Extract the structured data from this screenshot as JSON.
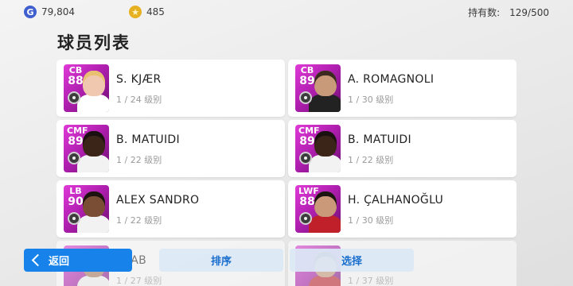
{
  "currency": {
    "gp": "79,804",
    "coins": "485"
  },
  "owned": {
    "label": "持有数:",
    "value": "129/500"
  },
  "page_title": "球员列表",
  "players": [
    {
      "pos": "CB",
      "rating": "88",
      "name": "S. KJÆR",
      "level": "1 / 24 级别",
      "skin": "#f0c8b0",
      "hair": "#e8c070",
      "kit": "#ffffff"
    },
    {
      "pos": "CB",
      "rating": "89",
      "name": "A. ROMAGNOLI",
      "level": "1 / 30 级别",
      "skin": "#c99a7a",
      "hair": "#3a2a20",
      "kit": "#222222"
    },
    {
      "pos": "CMF",
      "rating": "89",
      "name": "B. MATUIDI",
      "level": "1 / 22 级别",
      "skin": "#3b2418",
      "hair": "#1a1010",
      "kit": "#f2f2f2"
    },
    {
      "pos": "CMF",
      "rating": "89",
      "name": "B. MATUIDI",
      "level": "1 / 22 级别",
      "skin": "#3b2418",
      "hair": "#1a1010",
      "kit": "#f2f2f2"
    },
    {
      "pos": "LB",
      "rating": "90",
      "name": "ALEX SANDRO",
      "level": "1 / 22 级别",
      "skin": "#7a4e34",
      "hair": "#1c1210",
      "kit": "#f2f2f2"
    },
    {
      "pos": "LWF",
      "rating": "88",
      "name": "H. ÇALHANOĞLU",
      "level": "1 / 30 级别",
      "skin": "#c9997a",
      "hair": "#1c1410",
      "kit": "#c0202a"
    },
    {
      "pos": "",
      "rating": "",
      "name": "ALAB",
      "level": "1 / 27 级别",
      "skin": "#a8765a",
      "hair": "#1c1410",
      "kit": "#f2f2f2"
    },
    {
      "pos": "",
      "rating": "",
      "name": "",
      "level": "1 / 37 级别",
      "skin": "#c9997a",
      "hair": "#2a1a10",
      "kit": "#c0202a"
    }
  ],
  "buttons": {
    "back": "返回",
    "sort": "排序",
    "select": "选择"
  }
}
